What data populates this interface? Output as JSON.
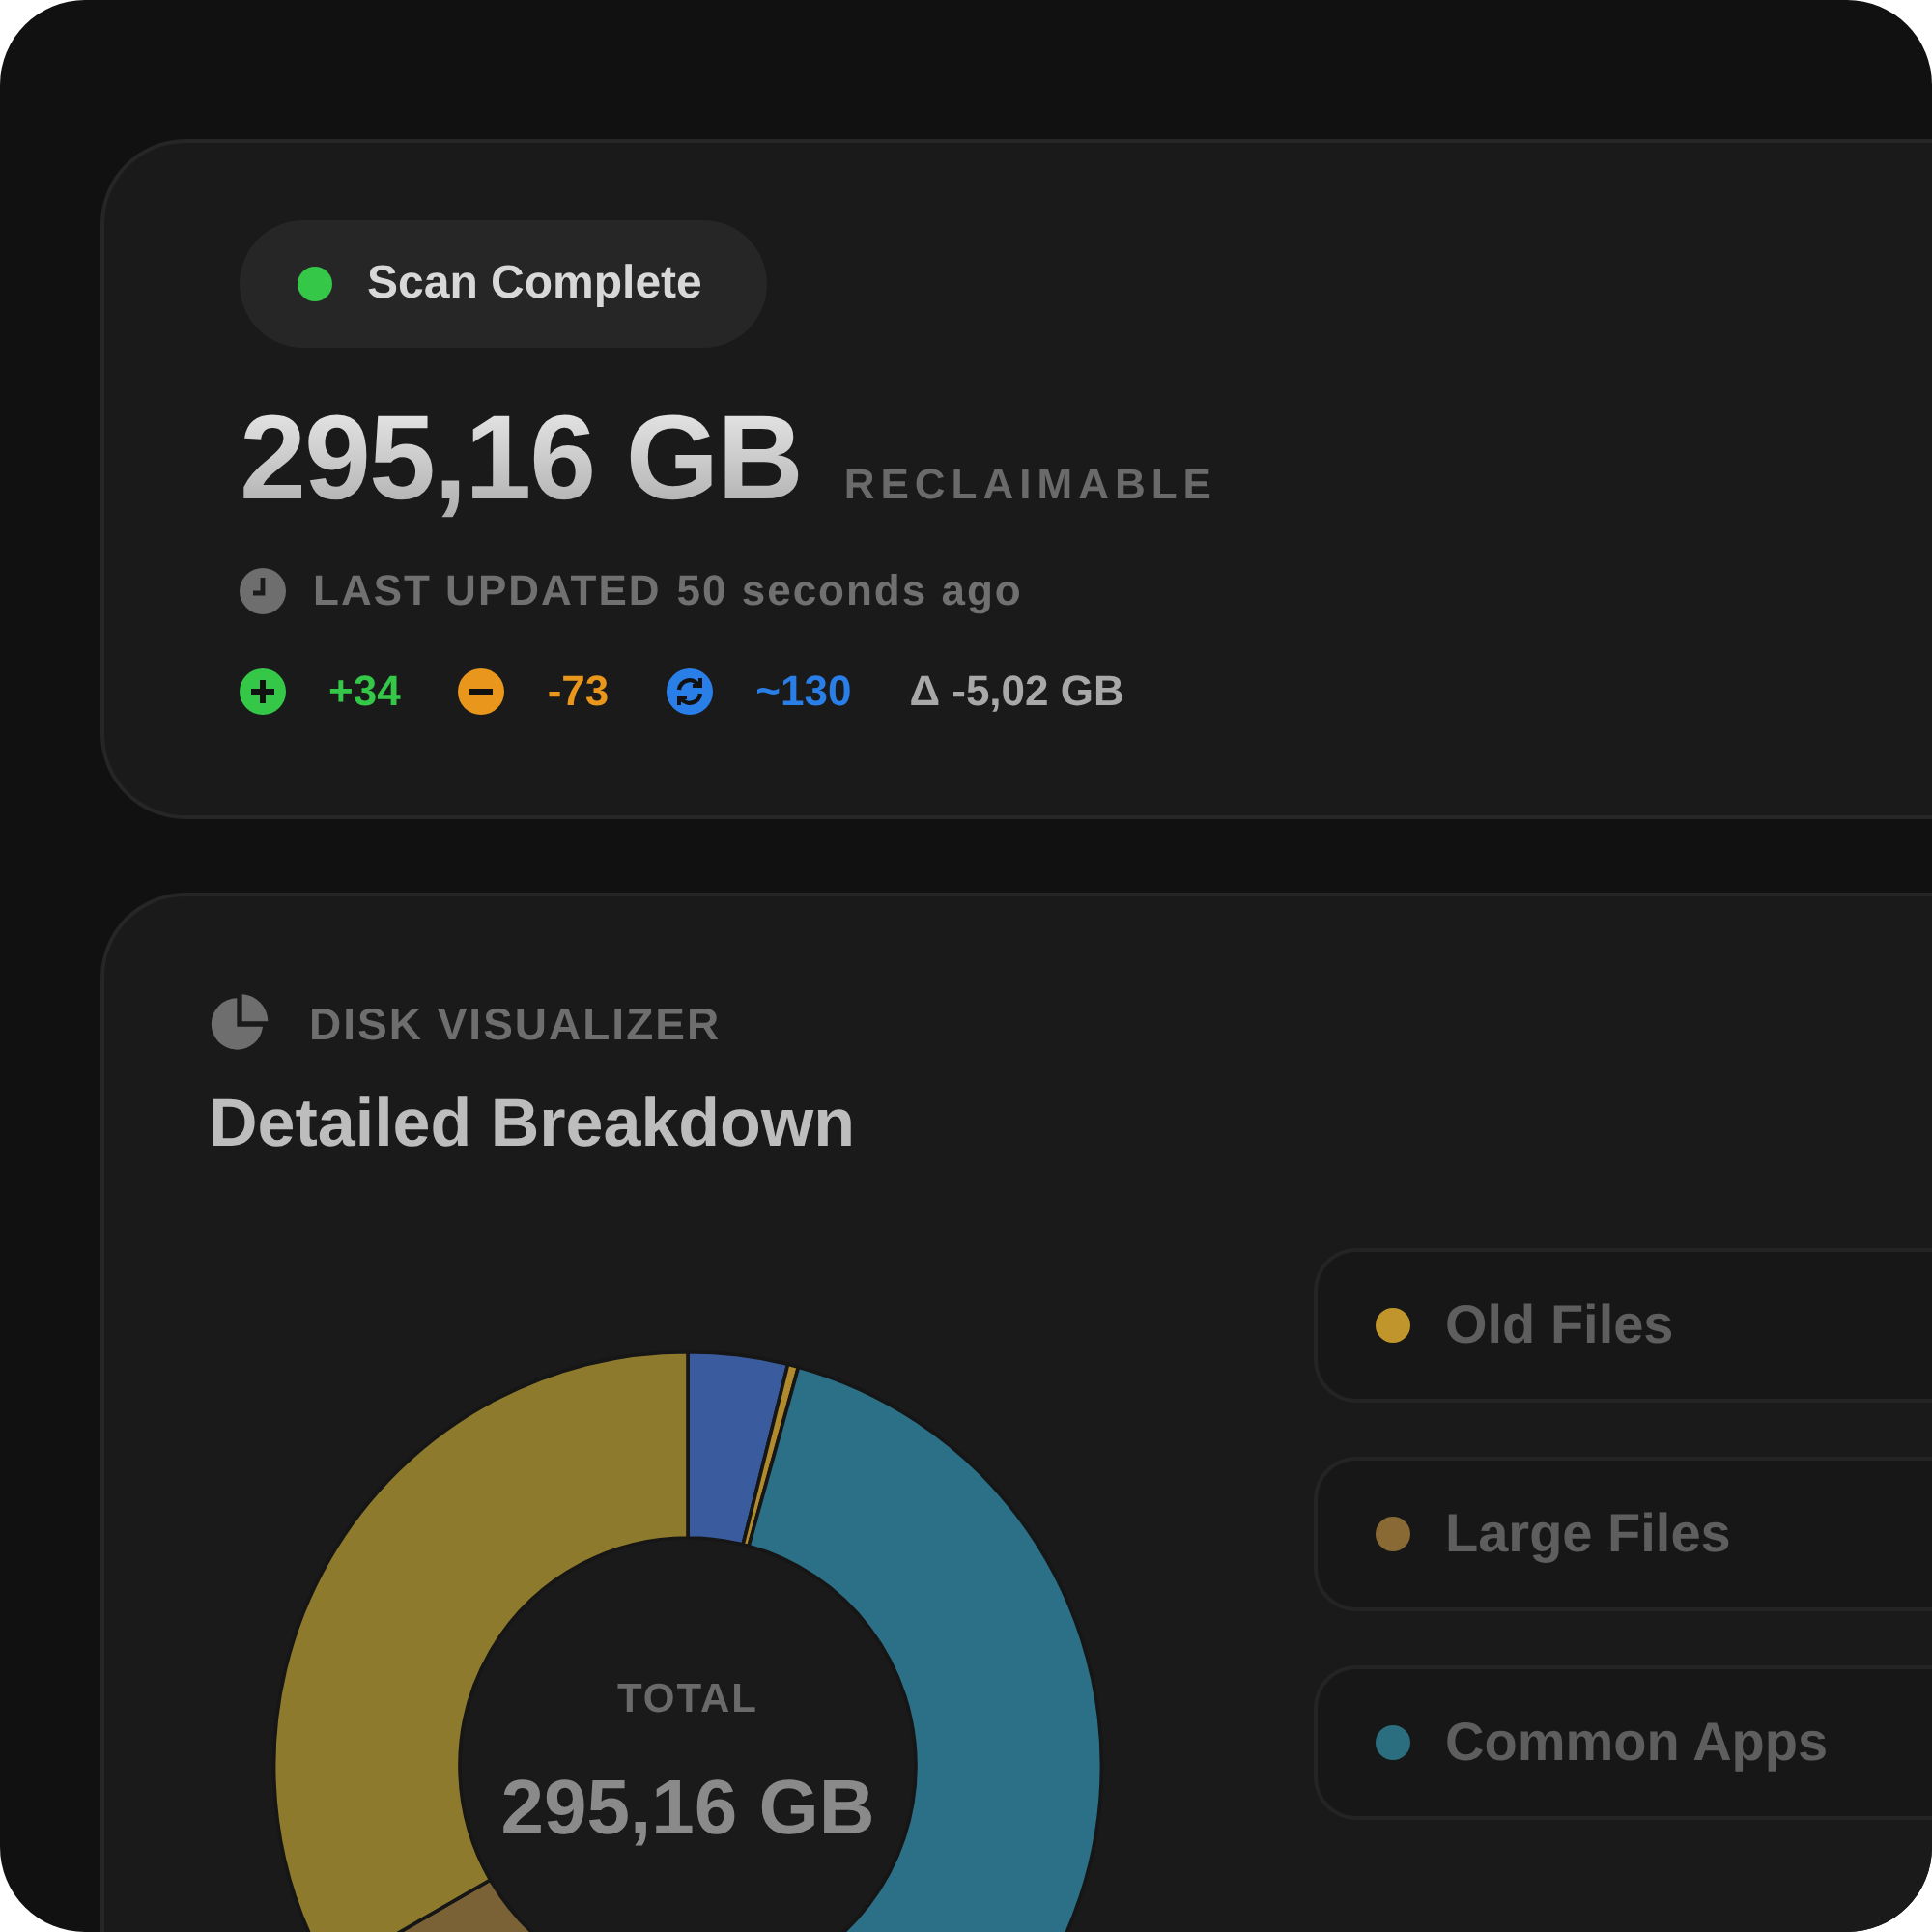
{
  "status": {
    "label": "Scan Complete",
    "color": "#34c748"
  },
  "summary": {
    "amount": "295,16 GB",
    "caption": "RECLAIMABLE",
    "updated_label": "LAST UPDATED",
    "updated_time": "50 seconds ago"
  },
  "changes": [
    {
      "kind": "added",
      "text": "+34",
      "color": "#34c748"
    },
    {
      "kind": "removed",
      "text": "-73",
      "color": "#e8961c"
    },
    {
      "kind": "changed",
      "text": "~130",
      "color": "#2a7ee8"
    },
    {
      "kind": "delta",
      "text": "Δ -5,02 GB",
      "color": "#a8a8a8"
    }
  ],
  "visualizer": {
    "eyebrow": "DISK VISUALIZER",
    "title": "Detailed Breakdown",
    "total_label": "TOTAL",
    "total_value": "295,16 GB",
    "legend": [
      {
        "label": "Old Files",
        "color": "#c0962c"
      },
      {
        "label": "Large Files",
        "color": "#8a6a34"
      },
      {
        "label": "Common Apps",
        "color": "#2a6e80"
      }
    ]
  }
}
